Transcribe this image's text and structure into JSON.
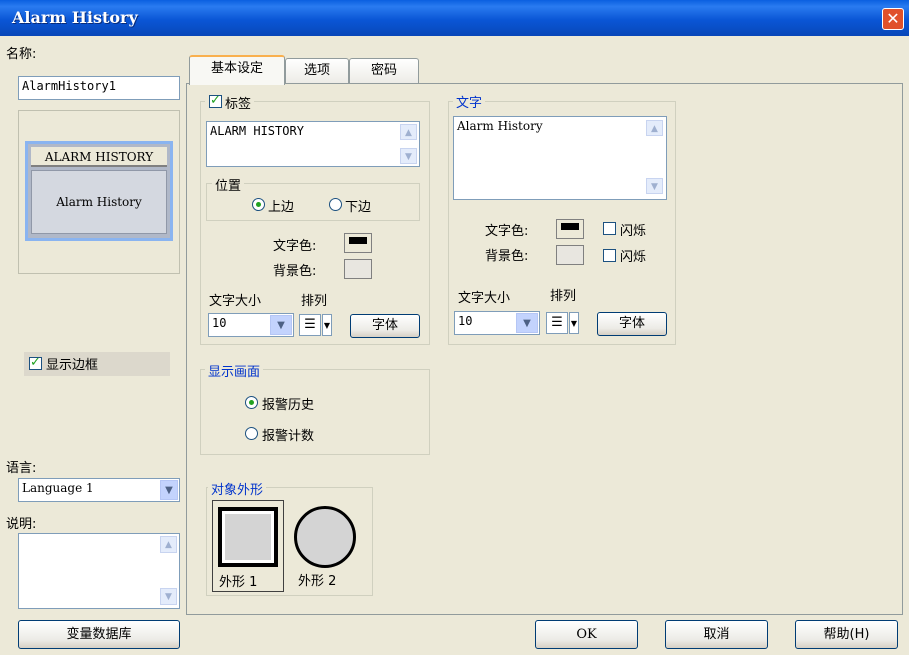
{
  "window": {
    "title": "Alarm History",
    "close_glyph": "✕"
  },
  "left": {
    "name_label": "名称:",
    "name_value": "AlarmHistory1",
    "preview": {
      "header": "ALARM HISTORY",
      "body": "Alarm History"
    },
    "show_border_label": "显示边框",
    "show_border_checked": true,
    "language_label": "语言:",
    "language_value": "Language 1",
    "description_label": "说明:",
    "description_value": "",
    "tag_db_button": "变量数据库"
  },
  "tabs": [
    {
      "label": "基本设定",
      "active": true
    },
    {
      "label": "选项",
      "active": false
    },
    {
      "label": "密码",
      "active": false
    }
  ],
  "label_group": {
    "title": "标签",
    "checked": true,
    "text": "ALARM HISTORY",
    "position_title": "位置",
    "pos_top": "上边",
    "pos_bottom": "下边",
    "selected": "top",
    "text_color_label": "文字色:",
    "bg_color_label": "背景色:",
    "font_size_label": "文字大小",
    "align_label": "排列",
    "font_size": "10",
    "font_button": "字体"
  },
  "text_group": {
    "title": "文字",
    "text": "Alarm History",
    "text_color_label": "文字色:",
    "bg_color_label": "背景色:",
    "blink_label": "闪烁",
    "font_size_label": "文字大小",
    "align_label": "排列",
    "font_size": "10",
    "font_button": "字体"
  },
  "display_group": {
    "title": "显示画面",
    "opt1": "报警历史",
    "opt2": "报警计数",
    "selected": "opt1"
  },
  "shape_group": {
    "title": "对象外形",
    "shape1": "外形 1",
    "shape2": "外形 2"
  },
  "footer": {
    "ok": "OK",
    "cancel": "取消",
    "help": "帮助(H)"
  },
  "colors": {
    "titlebar": "#0A56D6",
    "dialog": "#ECE9D8",
    "accent_blue": "#0033CC",
    "check_green": "#21A121",
    "text_swatch": "#000000",
    "bg_swatch": "#ECE9D8"
  }
}
